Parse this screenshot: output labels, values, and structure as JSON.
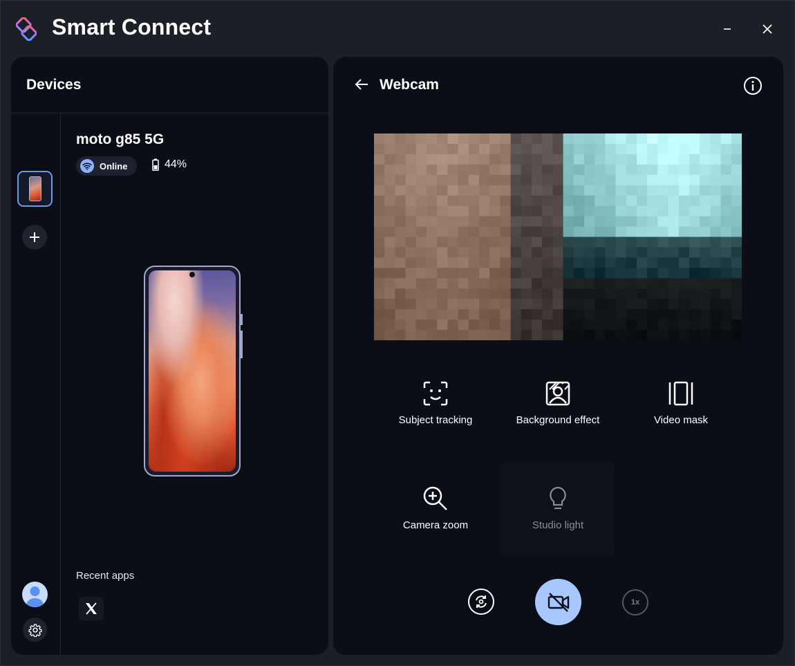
{
  "app": {
    "title": "Smart Connect",
    "icons": {
      "logo": "smart-connect-logo",
      "minimize": "minimize-icon",
      "close": "close-icon"
    }
  },
  "devices_panel": {
    "title": "Devices",
    "device": {
      "name": "moto g85 5G",
      "status": "Online",
      "battery": "44%"
    },
    "recent_apps_label": "Recent apps",
    "recent_apps": [
      {
        "name": "X",
        "icon": "x-logo-icon"
      }
    ]
  },
  "webcam_panel": {
    "title": "Webcam",
    "features": [
      {
        "label": "Subject tracking",
        "icon": "subject-tracking-icon",
        "enabled": true
      },
      {
        "label": "Background effect",
        "icon": "background-effect-icon",
        "enabled": true
      },
      {
        "label": "Video mask",
        "icon": "video-mask-icon",
        "enabled": true
      },
      {
        "label": "Camera zoom",
        "icon": "camera-zoom-icon",
        "enabled": true
      },
      {
        "label": "Studio light",
        "icon": "lightbulb-icon",
        "enabled": false
      }
    ],
    "controls": {
      "zoom_level": "1x"
    }
  },
  "colors": {
    "window_bg": "#1c1f26",
    "panel_bg": "#0b0e16",
    "accent": "#a9c7ff",
    "selection_border": "#6f97ea",
    "disabled_text": "#8a8d96"
  }
}
